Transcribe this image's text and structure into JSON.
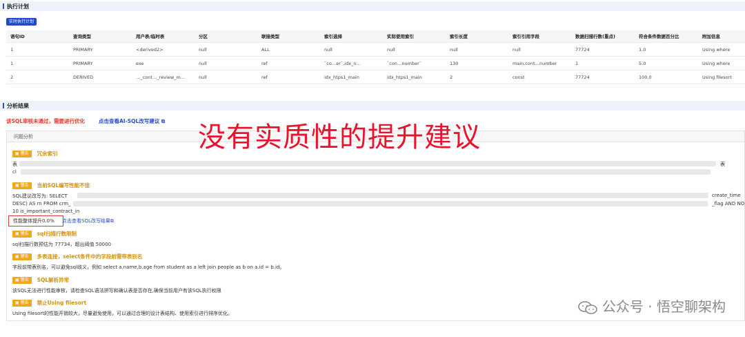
{
  "exec_plan": {
    "title": "执行计划",
    "run_button": "实时执行计划",
    "columns": [
      "语句ID",
      "查询类型",
      "用户表/临时表",
      "分区",
      "联接类型",
      "索引选择",
      "实际使用索引",
      "索引长度",
      "索引引用字段",
      "数据扫描行数(重点)",
      "符合条件数据百分比",
      "附加信息"
    ],
    "rows": [
      [
        "1",
        "PRIMARY",
        "<derived2>",
        "null",
        "ALL",
        "null",
        "null",
        "null",
        "null",
        "77724",
        "1.0",
        "Using where"
      ],
      [
        "1",
        "PRIMARY",
        "exe",
        "null",
        "ref",
        "`co…er`,idx_n…",
        "`con…number`",
        "130",
        "main.cont…number",
        "1",
        "5.0",
        "Using where"
      ],
      [
        "2",
        "DERIVED",
        "…_cont…_review_m…",
        "null",
        "ref",
        "idx_htps1_main",
        "idx_htps1_main",
        "2",
        "const",
        "77724",
        "100.0",
        "Using filesort"
      ]
    ]
  },
  "analysis": {
    "title": "分析结果",
    "fail_text": "该SQL审核未通过，需要进行优化",
    "ai_link": "点击查看AI-SQL改写建议",
    "overlay": "没有实质性的提升建议",
    "panel_title": "问题分析",
    "warnings": [
      {
        "badge": "警告",
        "title": "冗余索引",
        "line1": "表",
        "line1_end": "表",
        "line2": "cl"
      },
      {
        "badge": "警告",
        "title": "当前SQL编写性能不佳",
        "line1": "SQL建议改写为: SELECT",
        "line1_end": "create_time",
        "line2": "DESC) AS rn FROM crm_",
        "line2_end": "_flag AND NO",
        "line3": "10 is_important_contract_in",
        "perf": "性能整体提升0.0%",
        "link": "点击查看SQL改写结果"
      },
      {
        "badge": "警告",
        "title": "sql扫描行数限制",
        "body": "sql扫描行数预估为 77734，超出阈值 50000"
      },
      {
        "badge": "警告",
        "title": "多表连接，select条件中的字段前需带表别名",
        "body": "字段前带表别名，可以避免sql歧义，例如 select a.name,b.age from student as a left join people as b on a.id = b.id。"
      },
      {
        "badge": "警告",
        "title": "SQL解析异常",
        "body": "该SQL无法进行性能审核，请检查SQL语法拼写和确认表是否存在,确保当前用户有该SQL执行权限"
      },
      {
        "badge": "警告",
        "title": "禁止Using filesort",
        "body": "Using filesort的性能开销较大，尽量避免使用，可以通过合理的设计表结构、使用索引进行排序优化。"
      }
    ]
  },
  "watermark": "公众号 · 悟空聊架构",
  "colors": {
    "accent": "#2347c9",
    "warn": "#f0a81b",
    "error": "#e23b2b",
    "overlay": "#e8132c"
  }
}
